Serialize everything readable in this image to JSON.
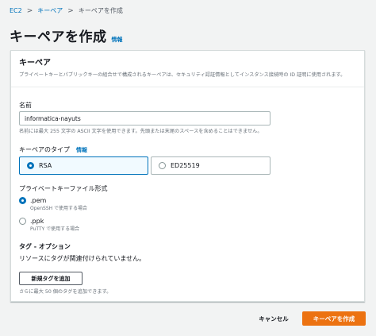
{
  "breadcrumb": {
    "items": [
      "EC2",
      "キーペア",
      "キーペアを作成"
    ],
    "separator": ">"
  },
  "page": {
    "title": "キーペアを作成",
    "info_link": "情報"
  },
  "panel": {
    "title": "キーペア",
    "description": "プライベートキーとパブリックキーの組合せで構成されるキーペアは、セキュリティ認証情報としてインスタンス接続時の ID 証明に使用されます。"
  },
  "name_field": {
    "label": "名前",
    "value": "informatica-nayuts",
    "hint": "名前には最大 255 文字の ASCII 文字を使用できます。先頭または末尾のスペースを含めることはできません。"
  },
  "key_type": {
    "label": "キーペアのタイプ",
    "info_link": "情報",
    "options": [
      {
        "label": "RSA",
        "selected": true
      },
      {
        "label": "ED25519",
        "selected": false
      }
    ]
  },
  "file_format": {
    "label": "プライベートキーファイル形式",
    "options": [
      {
        "label": ".pem",
        "description": "OpenSSH で使用する場合",
        "selected": true
      },
      {
        "label": ".ppk",
        "description": "PuTTY で使用する場合",
        "selected": false
      }
    ]
  },
  "tags": {
    "label": "タグ - オプション",
    "empty_text": "リソースにタグが関連付けられていません。",
    "add_button": "新規タグを追加",
    "hint": "さらに最大 50 個のタグを追加できます。"
  },
  "footer": {
    "cancel_label": "キャンセル",
    "submit_label": "キーペアを作成"
  },
  "colors": {
    "link": "#0073bb",
    "primary": "#ec7211",
    "selected_border": "#0073bb"
  }
}
